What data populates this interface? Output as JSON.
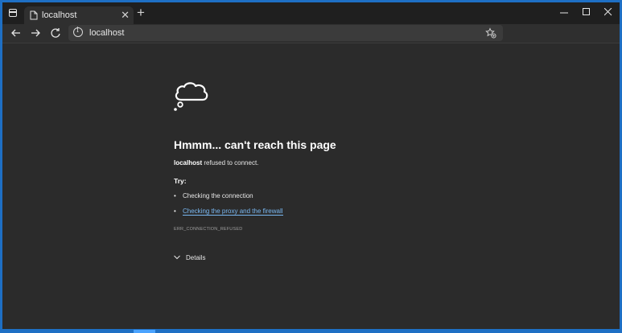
{
  "browser": {
    "tab_title": "localhost",
    "url": "localhost"
  },
  "error_page": {
    "heading": "Hmmm... can't reach this page",
    "host": "localhost",
    "message_suffix": " refused to connect.",
    "try_label": "Try:",
    "suggestions": [
      {
        "text": "Checking the connection",
        "is_link": false
      },
      {
        "text": "Checking the proxy and the firewall",
        "is_link": true
      }
    ],
    "error_code": "ERR_CONNECTION_REFUSED",
    "details_label": "Details"
  },
  "icons": {
    "tab_actions": "tab-actions-icon",
    "favicon": "page-favicon-icon",
    "close_tab": "close-icon",
    "new_tab": "plus-icon",
    "minimize": "minimize-icon",
    "maximize": "maximize-icon",
    "close_window": "close-icon",
    "back": "arrow-left-icon",
    "forward": "arrow-right-icon",
    "refresh": "refresh-icon",
    "site_info": "info-icon",
    "favorites": "star-add-icon",
    "thought_cloud": "thought-cloud-icon",
    "chevron": "chevron-down-icon"
  },
  "colors": {
    "window_bg": "#2b2b2b",
    "titlebar_bg": "#1f1f1f",
    "link": "#79b8f2",
    "desktop_accent": "#1e6fc4"
  }
}
